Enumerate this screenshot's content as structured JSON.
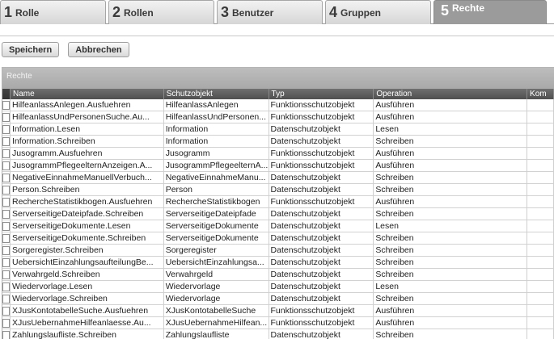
{
  "tabs": [
    {
      "num": "1",
      "label": "Rolle"
    },
    {
      "num": "2",
      "label": "Rollen"
    },
    {
      "num": "3",
      "label": "Benutzer"
    },
    {
      "num": "4",
      "label": "Gruppen"
    },
    {
      "num": "5",
      "label": "Rechte"
    }
  ],
  "toolbar": {
    "save_label": "Speichern",
    "cancel_label": "Abbrechen"
  },
  "panel": {
    "title": "Rechte"
  },
  "columns": [
    "Name",
    "Schutzobjekt",
    "Typ",
    "Operation",
    "Kom"
  ],
  "rows": [
    [
      "HilfeanlassAnlegen.Ausfuehren",
      "HilfeanlassAnlegen",
      "Funktionsschutzobjekt",
      "Ausführen"
    ],
    [
      "HilfeanlassUndPersonenSuche.Au...",
      "HilfeanlassUndPersonen...",
      "Funktionsschutzobjekt",
      "Ausführen"
    ],
    [
      "Information.Lesen",
      "Information",
      "Datenschutzobjekt",
      "Lesen"
    ],
    [
      "Information.Schreiben",
      "Information",
      "Datenschutzobjekt",
      "Schreiben"
    ],
    [
      "Jusogramm.Ausfuehren",
      "Jusogramm",
      "Funktionsschutzobjekt",
      "Ausführen"
    ],
    [
      "JusogrammPflegeelternAnzeigen.A...",
      "JusogrammPflegeelternA...",
      "Funktionsschutzobjekt",
      "Ausführen"
    ],
    [
      "NegativeEinnahmeManuellVerbuch...",
      "NegativeEinnahmeManu...",
      "Datenschutzobjekt",
      "Schreiben"
    ],
    [
      "Person.Schreiben",
      "Person",
      "Datenschutzobjekt",
      "Schreiben"
    ],
    [
      "RechercheStatistikbogen.Ausfuehren",
      "RechercheStatistikbogen",
      "Funktionsschutzobjekt",
      "Ausführen"
    ],
    [
      "ServerseitigeDateipfade.Schreiben",
      "ServerseitigeDateipfade",
      "Datenschutzobjekt",
      "Schreiben"
    ],
    [
      "ServerseitigeDokumente.Lesen",
      "ServerseitigeDokumente",
      "Datenschutzobjekt",
      "Lesen"
    ],
    [
      "ServerseitigeDokumente.Schreiben",
      "ServerseitigeDokumente",
      "Datenschutzobjekt",
      "Schreiben"
    ],
    [
      "Sorgeregister.Schreiben",
      "Sorgeregister",
      "Datenschutzobjekt",
      "Schreiben"
    ],
    [
      "UebersichtEinzahlungsaufteilungBe...",
      "UebersichtEinzahlungsa...",
      "Datenschutzobjekt",
      "Schreiben"
    ],
    [
      "Verwahrgeld.Schreiben",
      "Verwahrgeld",
      "Datenschutzobjekt",
      "Schreiben"
    ],
    [
      "Wiedervorlage.Lesen",
      "Wiedervorlage",
      "Datenschutzobjekt",
      "Lesen"
    ],
    [
      "Wiedervorlage.Schreiben",
      "Wiedervorlage",
      "Datenschutzobjekt",
      "Schreiben"
    ],
    [
      "XJusKontotabelleSuche.Ausfuehren",
      "XJusKontotabelleSuche",
      "Funktionsschutzobjekt",
      "Ausführen"
    ],
    [
      "XJusUebernahmeHilfeanlaesse.Au...",
      "XJusUebernahmeHilfean...",
      "Funktionsschutzobjekt",
      "Ausführen"
    ],
    [
      "Zahlungslaufliste.Schreiben",
      "Zahlungslaufliste",
      "Datenschutzobjekt",
      "Schreiben"
    ]
  ]
}
